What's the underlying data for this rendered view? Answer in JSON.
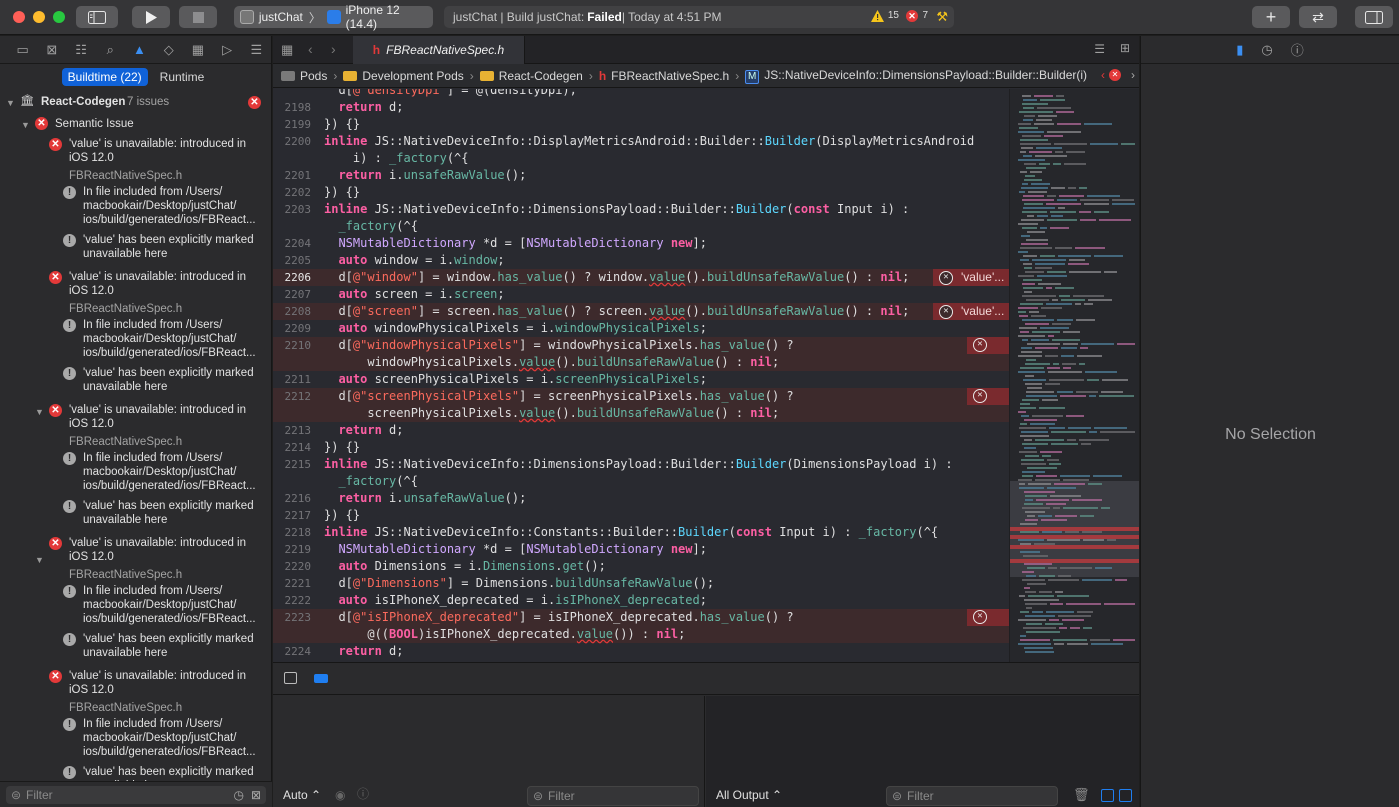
{
  "toolbar": {
    "scheme": "justChat",
    "device": "iPhone 12 (14.4)",
    "activity_prefix": "justChat | Build justChat: ",
    "activity_status": "Failed",
    "activity_time": " | Today at 4:51 PM",
    "warnings": "15",
    "errors": "7"
  },
  "navigator": {
    "tabs": [
      "Buildtime (22)",
      "Runtime"
    ],
    "group": "React-Codegen",
    "group_count": "7 issues",
    "category": "Semantic Issue",
    "error_line1": "'value' is unavailable: introduced in",
    "error_line2": "iOS 12.0",
    "file": "FBReactNativeSpec.h",
    "note1_l1": "In file included from /Users/",
    "note1_l2": "macbookair/Desktop/justChat/",
    "note1_l3": "ios/build/generated/ios/FBReact...",
    "note2_l1": "'value' has been explicitly marked",
    "note2_l2": "unavailable here",
    "filter_placeholder": "Filter"
  },
  "editor": {
    "tab_title": "FBReactNativeSpec.h",
    "breadcrumb": [
      "Pods",
      "Development Pods",
      "React-Codegen",
      "FBReactNativeSpec.h",
      "JS::NativeDeviceInfo::DimensionsPayload::Builder::Builder(i)"
    ],
    "error_message": "'value'...",
    "lines": [
      {
        "n": "2198",
        "h": "  <span class=\"k\">return</span> d;"
      },
      {
        "n": "2199",
        "h": "}) {}"
      },
      {
        "n": "2200",
        "h": "<span class=\"k\">inline</span> JS::NativeDeviceInfo::DisplayMetricsAndroid::Builder::<span class=\"c\">Builder</span>(DisplayMetricsAndroid"
      },
      {
        "n": "",
        "h": "    i) : <span class=\"f\">_factory</span>(^{"
      },
      {
        "n": "2201",
        "h": "  <span class=\"k\">return</span> i.<span class=\"f\">unsafeRawValue</span>();"
      },
      {
        "n": "2202",
        "h": "}) {}"
      },
      {
        "n": "2203",
        "h": "<span class=\"k\">inline</span> JS::NativeDeviceInfo::DimensionsPayload::Builder::<span class=\"c\">Builder</span>(<span class=\"k\">const</span> Input i) :"
      },
      {
        "n": "",
        "h": "  <span class=\"f\">_factory</span>(^{"
      },
      {
        "n": "2204",
        "h": "  <span class=\"t\">NSMutableDictionary</span> *d = [<span class=\"t\">NSMutableDictionary</span> <span class=\"k\">new</span>];"
      },
      {
        "n": "2205",
        "h": "  <span class=\"k\">auto</span> window = i.<span class=\"f\">window</span>;"
      },
      {
        "n": "2206",
        "h": "  d[<span class=\"s\">@\"window\"</span>] = window.<span class=\"f\">has_value</span>() ? window.<span class=\"f u\">value</span>().<span class=\"f\">buildUnsafeRawValue</span>() : <span class=\"k\">nil</span>;",
        "err": "msg",
        "cur": true
      },
      {
        "n": "2207",
        "h": "  <span class=\"k\">auto</span> screen = i.<span class=\"f\">screen</span>;"
      },
      {
        "n": "2208",
        "h": "  d[<span class=\"s\">@\"screen\"</span>] = screen.<span class=\"f\">has_value</span>() ? screen.<span class=\"f u\">value</span>().<span class=\"f\">buildUnsafeRawValue</span>() : <span class=\"k\">nil</span>;",
        "err": "msg"
      },
      {
        "n": "2209",
        "h": "  <span class=\"k\">auto</span> windowPhysicalPixels = i.<span class=\"f\">windowPhysicalPixels</span>;"
      },
      {
        "n": "2210",
        "h": "  d[<span class=\"s\">@\"windowPhysicalPixels\"</span>] = windowPhysicalPixels.<span class=\"f\">has_value</span>() ?",
        "err": "icon"
      },
      {
        "n": "",
        "h": "      windowPhysicalPixels.<span class=\"f u\">value</span>().<span class=\"f\">buildUnsafeRawValue</span>() : <span class=\"k\">nil</span>;",
        "bg": true
      },
      {
        "n": "2211",
        "h": "  <span class=\"k\">auto</span> screenPhysicalPixels = i.<span class=\"f\">screenPhysicalPixels</span>;"
      },
      {
        "n": "2212",
        "h": "  d[<span class=\"s\">@\"screenPhysicalPixels\"</span>] = screenPhysicalPixels.<span class=\"f\">has_value</span>() ?",
        "err": "icon"
      },
      {
        "n": "",
        "h": "      screenPhysicalPixels.<span class=\"f u\">value</span>().<span class=\"f\">buildUnsafeRawValue</span>() : <span class=\"k\">nil</span>;",
        "bg": true
      },
      {
        "n": "2213",
        "h": "  <span class=\"k\">return</span> d;"
      },
      {
        "n": "2214",
        "h": "}) {}"
      },
      {
        "n": "2215",
        "h": "<span class=\"k\">inline</span> JS::NativeDeviceInfo::DimensionsPayload::Builder::<span class=\"c\">Builder</span>(DimensionsPayload i) :"
      },
      {
        "n": "",
        "h": "  <span class=\"f\">_factory</span>(^{"
      },
      {
        "n": "2216",
        "h": "  <span class=\"k\">return</span> i.<span class=\"f\">unsafeRawValue</span>();"
      },
      {
        "n": "2217",
        "h": "}) {}"
      },
      {
        "n": "2218",
        "h": "<span class=\"k\">inline</span> JS::NativeDeviceInfo::Constants::Builder::<span class=\"c\">Builder</span>(<span class=\"k\">const</span> Input i) : <span class=\"f\">_factory</span>(^{"
      },
      {
        "n": "2219",
        "h": "  <span class=\"t\">NSMutableDictionary</span> *d = [<span class=\"t\">NSMutableDictionary</span> <span class=\"k\">new</span>];"
      },
      {
        "n": "2220",
        "h": "  <span class=\"k\">auto</span> Dimensions = i.<span class=\"f\">Dimensions</span>.<span class=\"f\">get</span>();"
      },
      {
        "n": "2221",
        "h": "  d[<span class=\"s\">@\"Dimensions\"</span>] = Dimensions.<span class=\"f\">buildUnsafeRawValue</span>();"
      },
      {
        "n": "2222",
        "h": "  <span class=\"k\">auto</span> isIPhoneX_deprecated = i.<span class=\"f\">isIPhoneX_deprecated</span>;"
      },
      {
        "n": "2223",
        "h": "  d[<span class=\"s\">@\"isIPhoneX_deprecated\"</span>] = isIPhoneX_deprecated.<span class=\"f\">has_value</span>() ?",
        "err": "icon"
      },
      {
        "n": "",
        "h": "      @((<span class=\"k\">BOOL</span>)isIPhoneX_deprecated.<span class=\"f u\">value</span>()) : <span class=\"k\">nil</span>;",
        "bg": true
      },
      {
        "n": "2224",
        "h": "  <span class=\"k\">return</span> d;"
      }
    ]
  },
  "debug": {
    "auto_label": "Auto",
    "filter_placeholder": "Filter",
    "output_label": "All Output",
    "filter2_placeholder": "Filter"
  },
  "inspector": {
    "empty_label": "No Selection"
  },
  "colors": {
    "error_red": "#e33939",
    "accent_blue": "#1062d8",
    "warning_yellow": "#f5c51b"
  }
}
